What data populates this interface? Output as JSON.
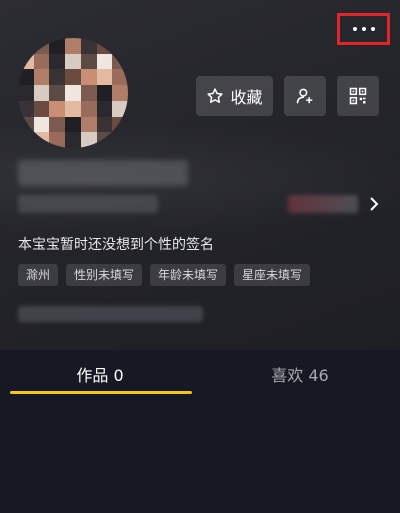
{
  "profile": {
    "signature": "本宝宝暂时还没想到个性的签名",
    "tags": [
      "滁州",
      "性别未填写",
      "年龄未填写",
      "星座未填写"
    ]
  },
  "actions": {
    "favorite_label": "收藏",
    "favorite_icon": "star-icon",
    "add_friend_icon": "add-user-icon",
    "qr_icon": "qr-code-icon",
    "more_icon": "more-dots-icon"
  },
  "tabs": [
    {
      "label": "作品 0",
      "active": true
    },
    {
      "label": "喜欢 46",
      "active": false
    }
  ],
  "colors": {
    "background": "#161823",
    "accent_underline": "#f5c518",
    "highlight_box": "#e3242b"
  }
}
